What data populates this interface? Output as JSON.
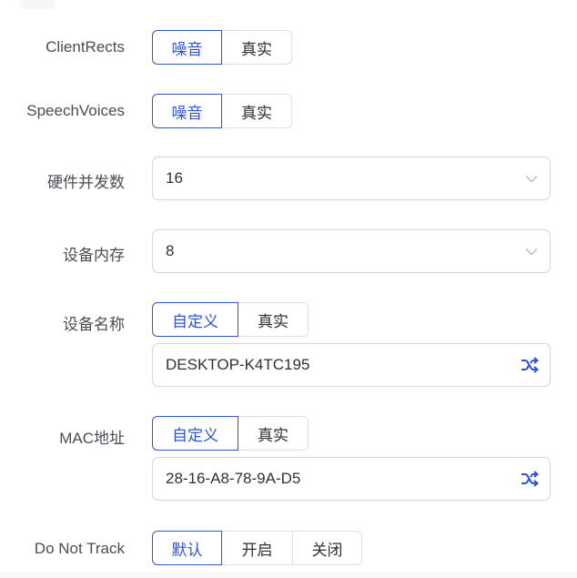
{
  "form": {
    "client_rects": {
      "label": "ClientRects",
      "options": [
        "噪音",
        "真实"
      ],
      "selected": "噪音"
    },
    "speech_voices": {
      "label": "SpeechVoices",
      "options": [
        "噪音",
        "真实"
      ],
      "selected": "噪音"
    },
    "hardware_concurrency": {
      "label": "硬件并发数",
      "value": "16"
    },
    "device_memory": {
      "label": "设备内存",
      "value": "8"
    },
    "device_name": {
      "label": "设备名称",
      "options": [
        "自定义",
        "真实"
      ],
      "selected": "自定义",
      "value": "DESKTOP-K4TC195"
    },
    "mac_address": {
      "label": "MAC地址",
      "options": [
        "自定义",
        "真实"
      ],
      "selected": "自定义",
      "value": "28-16-A8-78-9A-D5"
    },
    "do_not_track": {
      "label": "Do Not Track",
      "options": [
        "默认",
        "开启",
        "关闭"
      ],
      "selected": "默认"
    }
  },
  "icons": {
    "select_arrow": "chevron-down-icon",
    "randomize": "shuffle-icon"
  },
  "colors": {
    "accent": "#2f55d4",
    "border": "#dcdfe6",
    "label": "#4a4d55",
    "text": "#303133"
  }
}
